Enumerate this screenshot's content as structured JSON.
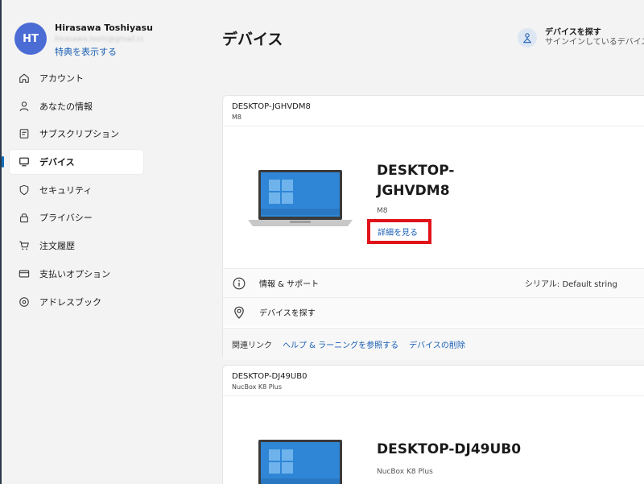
{
  "profile": {
    "initials": "HT",
    "name": "Hirasawa Toshiyasu",
    "email": "hirasawa.toshi@gmail.com",
    "benefits_link": "特典を表示する"
  },
  "sidebar": {
    "items": [
      {
        "label": "アカウント",
        "icon": "home-icon"
      },
      {
        "label": "あなたの情報",
        "icon": "person-icon"
      },
      {
        "label": "サブスクリプション",
        "icon": "subscription-icon"
      },
      {
        "label": "デバイス",
        "icon": "laptop-icon",
        "active": true
      },
      {
        "label": "セキュリティ",
        "icon": "shield-icon"
      },
      {
        "label": "プライバシー",
        "icon": "lock-icon"
      },
      {
        "label": "注文履歴",
        "icon": "cart-icon"
      },
      {
        "label": "支払いオプション",
        "icon": "card-icon"
      },
      {
        "label": "アドレスブック",
        "icon": "location-icon"
      }
    ]
  },
  "header": {
    "title": "デバイス",
    "find_title": "デバイスを探す",
    "find_desc": "サインインしているデバイスを探す"
  },
  "devices": [
    {
      "name": "DESKTOP-JGHVDM8",
      "model": "M8",
      "hero_name": "DESKTOP-JGHVDM8",
      "details_link": "詳細を見る",
      "info_label": "情報 & サポート",
      "serial": "シリアル: Default string",
      "find_label": "デバイスを探す",
      "related_label": "関連リンク",
      "help_link": "ヘルプ & ラーニングを参照する",
      "remove_link": "デバイスの削除"
    },
    {
      "name": "DESKTOP-DJ49UB0",
      "model": "NucBox K8 Plus",
      "hero_name": "DESKTOP-DJ49UB0"
    }
  ],
  "colors": {
    "accent": "#0f6cbd",
    "link": "#1a5fb4",
    "highlight_box": "#e0131a",
    "avatar": "#4a6cd4",
    "screen_blue": "#2f86d6"
  }
}
